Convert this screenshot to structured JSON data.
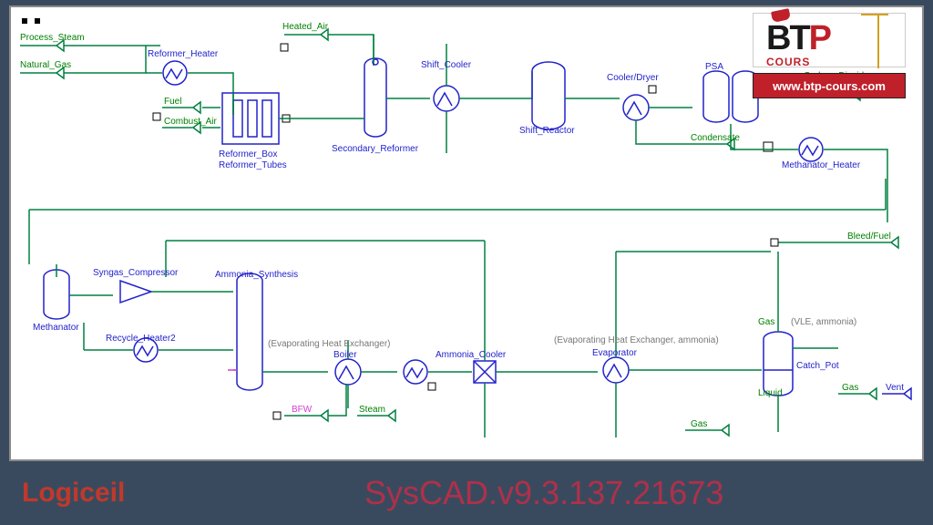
{
  "bottom": {
    "left": "Logiceil",
    "right": "SysCAD.v9.3.137.21673"
  },
  "logo": {
    "btp_b": "BT",
    "btp_p": "P",
    "cours": "COURS",
    "url": "www.btp-cours.com"
  },
  "labels": {
    "process_steam": "Process_Steam",
    "natural_gas": "Natural_Gas",
    "reformer_heater": "Reformer_Heater",
    "heated_air": "Heated_Air",
    "fuel": "Fuel",
    "combust_air": "Combust_Air",
    "reformer_box": "Reformer_Box",
    "reformer_tubes": "Reformer_Tubes",
    "secondary_reformer": "Secondary_Reformer",
    "shift_cooler": "Shift_Cooler",
    "shift_reactor": "Shift_Reactor",
    "cooler_dryer": "Cooler/Dryer",
    "condensate": "Condensate",
    "psa": "PSA",
    "carbon_dioxide": "Carbon_Dioxide",
    "methanator_heater": "Methanator_Heater",
    "bleed_fuel": "Bleed/Fuel",
    "syngas_compressor": "Syngas_Compressor",
    "ammonia_synthesis": "Ammonia_Synthesis",
    "methanator": "Methanator",
    "recycle_heater2": "Recycle_Heater2",
    "evap_heat_exchanger": "(Evaporating Heat Exchanger)",
    "boiler": "Boiler",
    "bfw": "BFW",
    "steam": "Steam",
    "ammonia_cooler": "Ammonia_Cooler",
    "evap_heat_exchanger_ammonia": "(Evaporating Heat Exchanger, ammonia)",
    "evaporator": "Evaporator",
    "gas": "Gas",
    "vle_ammonia": "(VLE, ammonia)",
    "catch_pot": "Catch_Pot",
    "liquid": "Liquid",
    "gas2": "Gas",
    "gas3": "Gas",
    "vent": "Vent"
  }
}
